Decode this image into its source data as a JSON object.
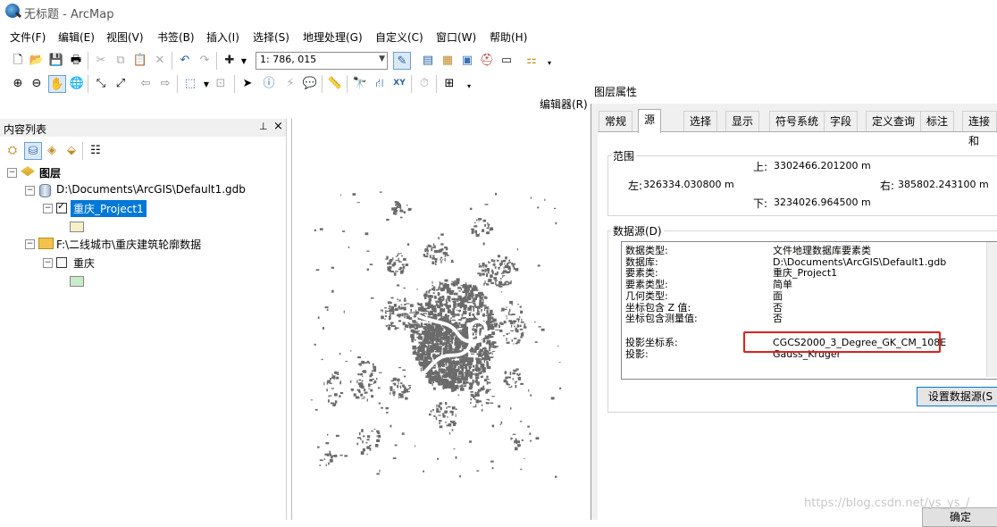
{
  "window": {
    "title": "无标题 - ArcMap"
  },
  "menu": [
    "文件(F)",
    "编辑(E)",
    "视图(V)",
    "书签(B)",
    "插入(I)",
    "选择(S)",
    "地理处理(G)",
    "自定义(C)",
    "窗口(W)",
    "帮助(H)"
  ],
  "toolbar": {
    "scale": "1: 786, 015",
    "editor_label": "编辑器(R)"
  },
  "toc": {
    "title": "内容列表",
    "pin": "ᵖ",
    "close": "×",
    "root": "图层",
    "gdb_path": "D:\\Documents\\ArcGIS\\Default1.gdb",
    "layer1": "重庆_Project1",
    "folder_path": "F:\\二线城市\\重庆建筑轮廓数据",
    "layer2": "重庆",
    "layer1_swatch": "#f5f0c8",
    "layer2_swatch": "#c8ecc8"
  },
  "dialog": {
    "title": "图层属性",
    "tabs": [
      "常规",
      "源",
      "选择",
      "显示",
      "符号系统",
      "字段",
      "定义查询",
      "标注",
      "连接和"
    ],
    "active_tab": "源",
    "extent": {
      "label": "范围",
      "top_label": "上:",
      "top": "3302466.201200 m",
      "left_label": "左:",
      "left": "326334.030800 m",
      "right_label": "右:",
      "right": "385802.243100 m",
      "bottom_label": "下:",
      "bottom": "3234026.964500 m"
    },
    "datasource": {
      "label": "数据源(D)",
      "rows": [
        {
          "key": "数据类型:",
          "value": "文件地理数据库要素类"
        },
        {
          "key": "数据库:",
          "value": "D:\\Documents\\ArcGIS\\Default1.gdb"
        },
        {
          "key": "要素类:",
          "value": "重庆_Project1"
        },
        {
          "key": "要素类型:",
          "value": "简单"
        },
        {
          "key": "几何类型:",
          "value": "面"
        },
        {
          "key": "坐标包含 Z 值:",
          "value": "否"
        },
        {
          "key": "坐标包含测量值:",
          "value": "否"
        },
        {
          "key": "投影坐标系:",
          "value": "CGCS2000_3_Degree_GK_CM_108E"
        },
        {
          "key": "投影:",
          "value": "Gauss_Kruger"
        }
      ]
    },
    "set_source_button": "设置数据源(S",
    "ok_button": "确定"
  },
  "watermark": "https://blog.csdn.net/ys_ys_/",
  "colors": {
    "map_feature": "#6b6b6b",
    "highlight": "#e0201b",
    "accent": "#0078d7"
  }
}
